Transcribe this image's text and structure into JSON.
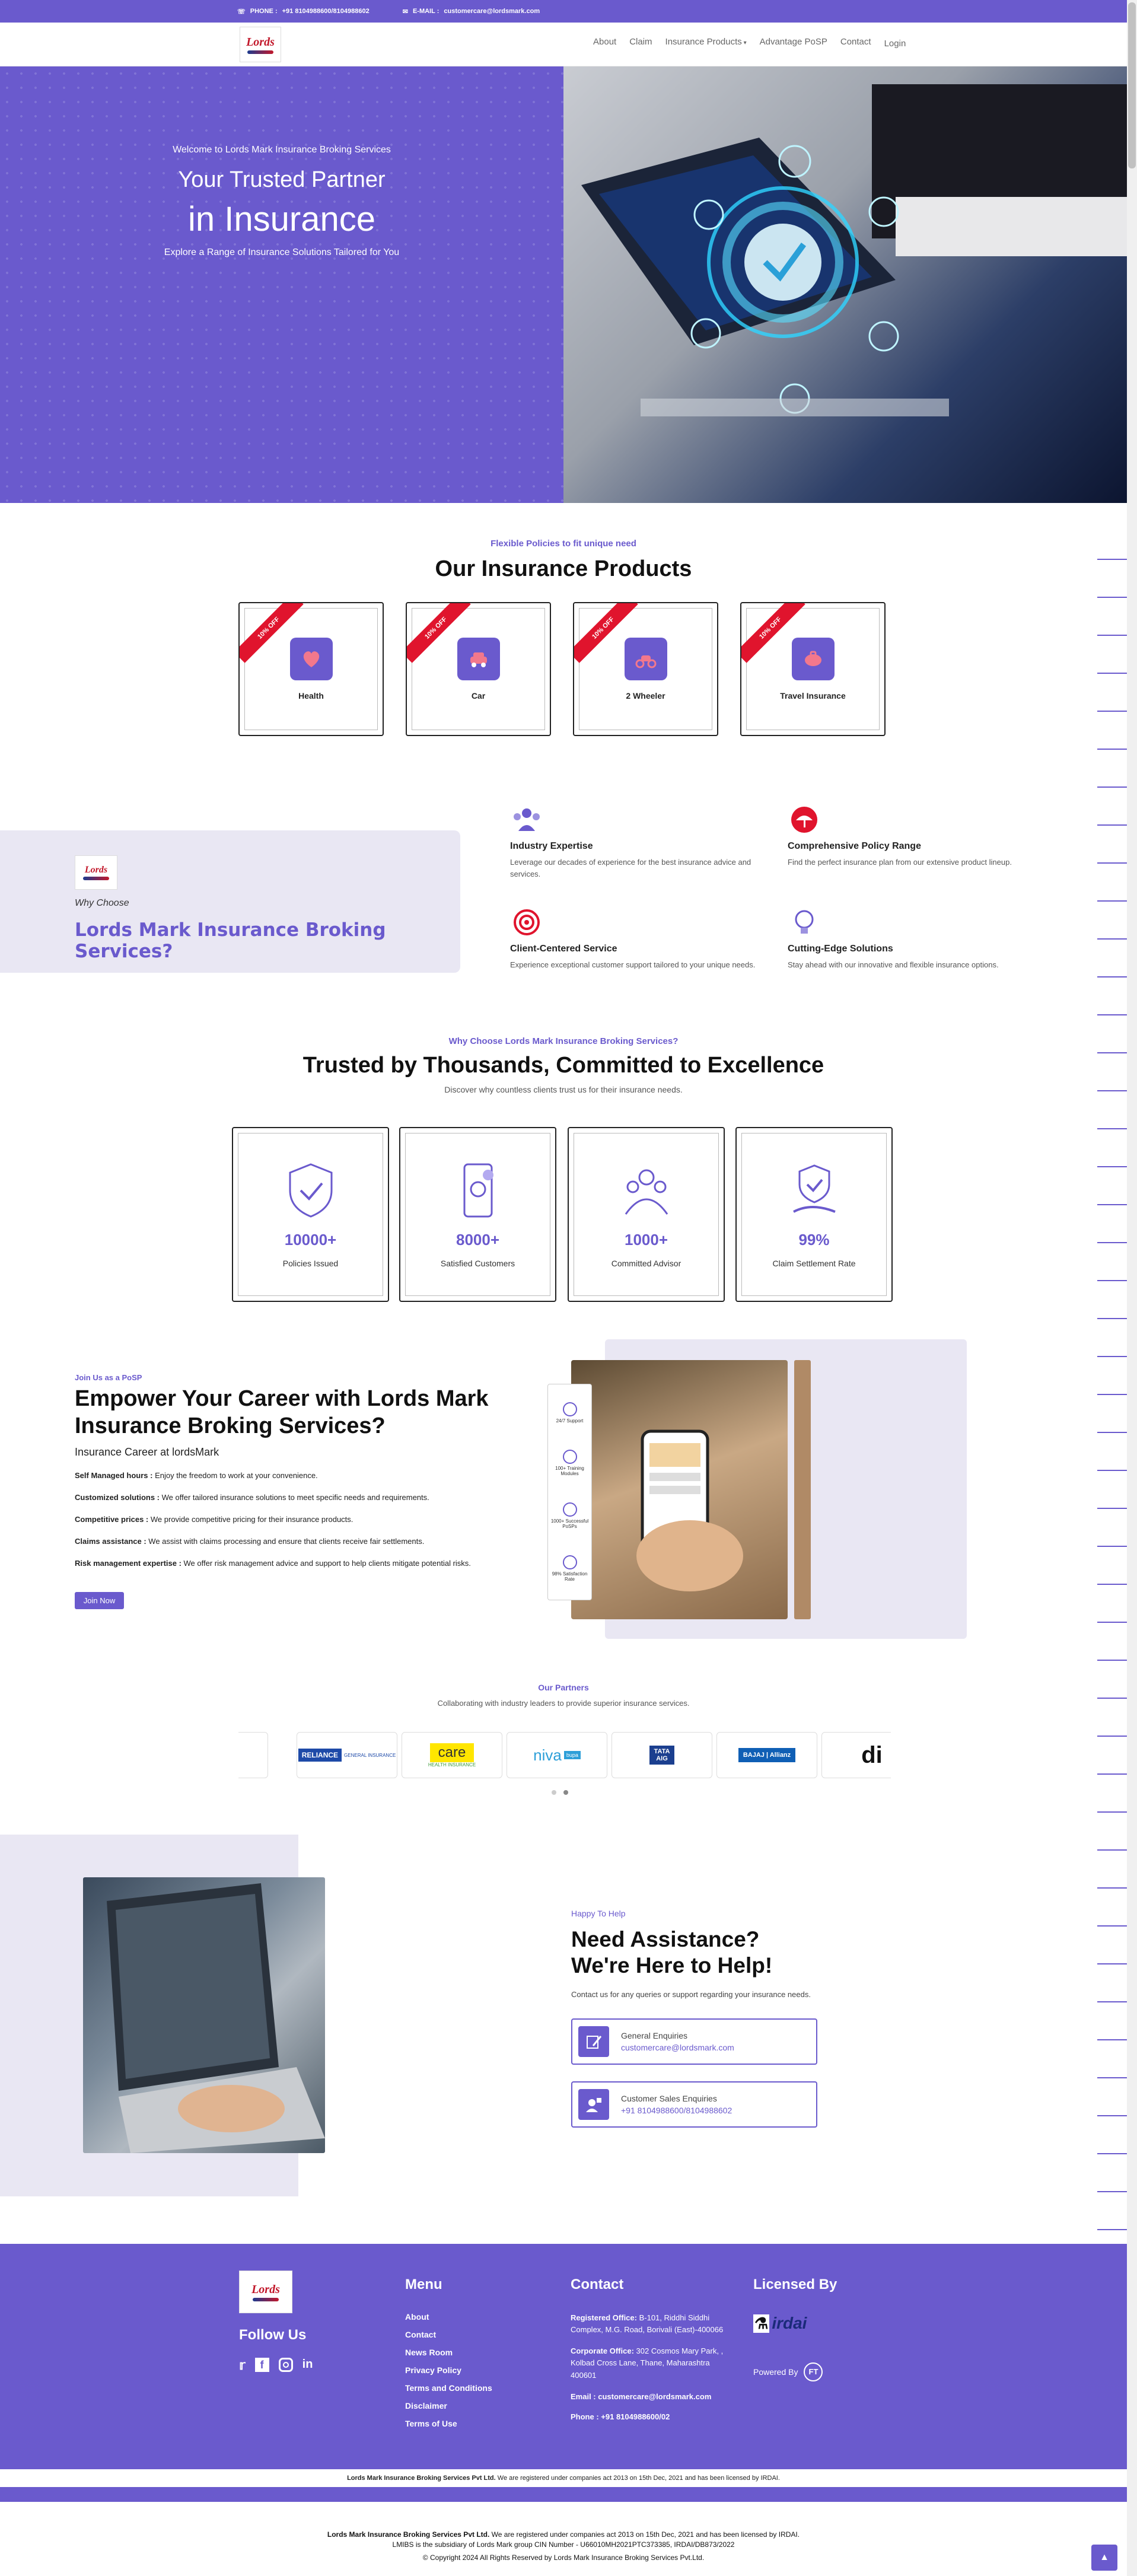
{
  "topbar": {
    "phone_label": "PHONE :",
    "phone": "+91 8104988600/8104988602",
    "email_label": "E-MAIL :",
    "email": "customercare@lordsmark.com"
  },
  "nav": {
    "items": [
      "About",
      "Claim",
      "Insurance Products",
      "Advantage PoSP",
      "Contact"
    ],
    "login": "Login",
    "logo_text": "Lords"
  },
  "hero": {
    "welcome": "Welcome to Lords Mark Insurance Broking Services",
    "title1": "Your Trusted Partner",
    "title2": "in Insurance",
    "subtitle": "Explore a Range of Insurance Solutions Tailored for You"
  },
  "products": {
    "eyebrow": "Flexible Policies to fit unique need",
    "title": "Our Insurance Products",
    "ribbon": "10% OFF",
    "items": [
      "Health",
      "Car",
      "2 Wheeler",
      "Travel Insurance"
    ]
  },
  "why": {
    "small": "Why Choose",
    "title": "Lords Mark Insurance Broking Services?",
    "features": [
      {
        "title": "Industry Expertise",
        "desc": "Leverage our decades of experience for the best insurance advice and services."
      },
      {
        "title": "Comprehensive Policy Range",
        "desc": "Find the perfect insurance plan from our extensive product lineup."
      },
      {
        "title": "Client-Centered Service",
        "desc": "Experience exceptional customer support tailored to your unique needs."
      },
      {
        "title": "Cutting-Edge Solutions",
        "desc": "Stay ahead with our innovative and flexible insurance options."
      }
    ]
  },
  "trust": {
    "eyebrow": "Why Choose Lords Mark Insurance Broking Services?",
    "title": "Trusted by Thousands, Committed to Excellence",
    "subtitle": "Discover why countless clients trust us for their insurance needs.",
    "stats": [
      {
        "num": "10000+",
        "label": "Policies Issued"
      },
      {
        "num": "8000+",
        "label": "Satisfied Customers"
      },
      {
        "num": "1000+",
        "label": "Committed Advisor"
      },
      {
        "num": "99%",
        "label": "Claim Settlement Rate"
      }
    ]
  },
  "career": {
    "eyebrow": "Join Us as a PoSP",
    "title1": "Empower Your Career with Lords Mark",
    "title2": "Insurance Broking Services?",
    "subtitle": "Insurance Career at lordsMark",
    "points": [
      {
        "b": "Self Managed hours :",
        "t": " Enjoy the freedom to work at your convenience."
      },
      {
        "b": "Customized solutions :",
        "t": " We offer tailored insurance solutions to meet specific needs and requirements."
      },
      {
        "b": "Competitive prices :",
        "t": " We provide competitive pricing for their insurance products."
      },
      {
        "b": "Claims assistance :",
        "t": " We assist with claims processing and ensure that clients receive fair settlements."
      },
      {
        "b": "Risk management expertise :",
        "t": " We offer risk management advice and support to help clients mitigate potential risks."
      }
    ],
    "button": "Join Now",
    "side_items": [
      "24/7 Support",
      "100+ Training Modules",
      "1000+ Successful PoSPs",
      "98% Satisfaction Rate"
    ]
  },
  "partners": {
    "eyebrow": "Our Partners",
    "subtitle": "Collaborating with industry leaders to provide superior insurance services.",
    "logos": [
      "RELIANCE",
      "GENERAL INSURANCE",
      "care",
      "HEALTH INSURANCE",
      "niva",
      "bupa",
      "TATA",
      "AIG",
      "BAJAJ",
      "Allianz"
    ]
  },
  "help": {
    "eyebrow": "Happy To Help",
    "title1": "Need Assistance?",
    "title2": "We're Here to Help!",
    "subtitle": "Contact us for any queries or support regarding your insurance needs.",
    "cards": [
      {
        "title": "General Enquiries",
        "value": "customercare@lordsmark.com"
      },
      {
        "title": "Customer Sales Enquiries",
        "value": "+91 8104988600/8104988602"
      }
    ]
  },
  "footer": {
    "follow": "Follow Us",
    "menu_title": "Menu",
    "menu": [
      "About",
      "Contact",
      "News Room",
      "Privacy Policy",
      "Terms and Conditions",
      "Disclaimer",
      "Terms of Use"
    ],
    "contact_title": "Contact",
    "reg_label": "Registered Office:",
    "reg": " B-101, Riddhi Siddhi Complex, M.G. Road, Borivali (East)-400066",
    "corp_label": "Corporate Office:",
    "corp": " 302 Cosmos Mary Park, , Kolbad Cross Lane, Thane, Maharashtra 400601",
    "email_label": "Email :",
    "email": " customercare@lordsmark.com",
    "phone_label": "Phone :",
    "phone": " +91 8104988600/02",
    "licensed_title": "Licensed By",
    "irdai": "irdai",
    "powered": "Powered By",
    "ft": "FT"
  },
  "bottom": {
    "company": "Lords Mark Insurance Broking Services Pvt Ltd.",
    "line1": " We are registered under companies act 2013 on 15th Dec, 2021 and has been licensed by IRDAI.",
    "line2": "LMIBS is the subsidiary of Lords Mark group CIN Number - U66010MH2021PTC373385, IRDAI/DB873/2022",
    "copyright": "© Copyright 2024 All Rights Reserved by Lords Mark Insurance Broking Services Pvt.Ltd."
  },
  "colors": {
    "brand": "#6a5acd",
    "ribbon": "#e0142d"
  }
}
